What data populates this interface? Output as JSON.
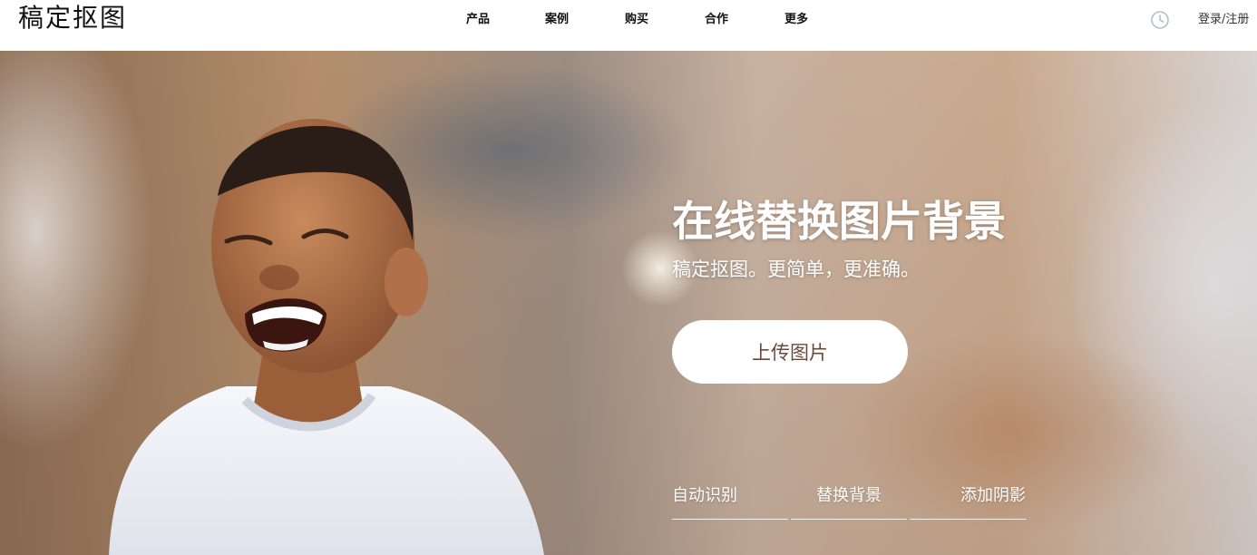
{
  "header": {
    "logo": "稿定抠图",
    "nav": [
      "产品",
      "案例",
      "购买",
      "合作",
      "更多"
    ],
    "login": "登录/注册"
  },
  "hero": {
    "headline": "在线替换图片背景",
    "subline": "稿定抠图。更简单，更准确。",
    "upload_button": "上传图片",
    "features": [
      "自动识别",
      "替换背景",
      "添加阴影"
    ]
  },
  "colors": {
    "button_text": "#6a4a3a",
    "header_bg": "#ffffff",
    "icon_gray": "#b9bcc8"
  }
}
